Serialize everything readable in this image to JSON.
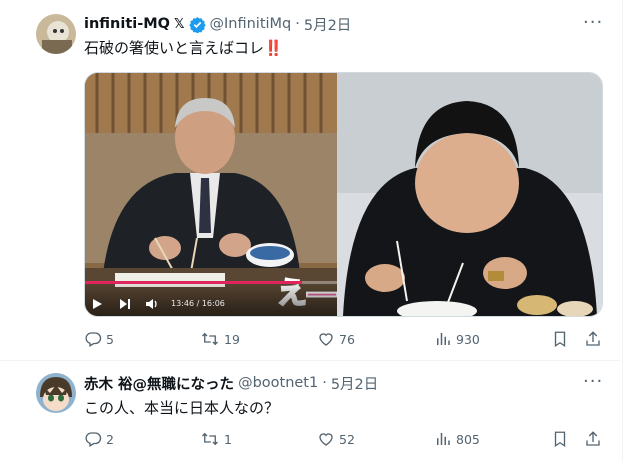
{
  "tweets": [
    {
      "display_name": "infiniti-MQ",
      "x_badge": "𝕏",
      "handle": "@InfinitiMq",
      "separator": "·",
      "date": "5月2日",
      "text": "石破の箸使いと言えばコレ‼️",
      "video": {
        "time_display": "13:46 / 16:06",
        "progress": 0.86,
        "overlay_text": "え―"
      },
      "actions": {
        "replies": "5",
        "retweets": "19",
        "likes": "76",
        "views": "930"
      }
    },
    {
      "display_name": "赤木 裕@無職になった",
      "handle": "@bootnet1",
      "separator": "·",
      "date": "5月2日",
      "text": "この人、本当に日本人なの？",
      "actions": {
        "replies": "2",
        "retweets": "1",
        "likes": "52",
        "views": "805"
      }
    }
  ],
  "colors": {
    "text_primary": "#0f1419",
    "text_secondary": "#536471",
    "verified_blue": "#1d9bf0",
    "divider": "#eff3f4",
    "emoji_red": "#d93a3a",
    "progress": "#e0245e"
  },
  "icons": [
    "more-icon",
    "verified-badge-icon",
    "reply-icon",
    "retweet-icon",
    "like-icon",
    "views-icon",
    "bookmark-icon",
    "share-icon",
    "play-icon",
    "skip-icon",
    "volume-icon"
  ]
}
